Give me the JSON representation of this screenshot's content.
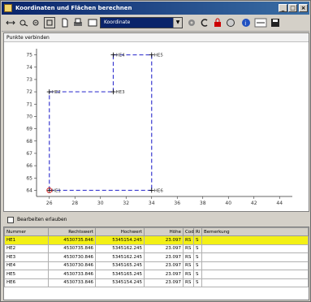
{
  "window": {
    "title": "Koordinaten und Flächen berechnen",
    "min_label": "_",
    "max_label": "□",
    "close_label": "×"
  },
  "toolbar": {
    "combo_value": "Koordinate",
    "tools": [
      "move-icon",
      "zoom-in-icon",
      "zoom-out-icon",
      "fit-icon",
      "new-icon",
      "print-icon",
      "settings-icon",
      "copy-icon",
      "save-icon",
      "info-icon",
      "calc-icon",
      "disk-icon"
    ]
  },
  "panel": {
    "title": "Punkte verbinden"
  },
  "chart_data": {
    "type": "line",
    "x_ticks": [
      "26",
      "28",
      "30",
      "32",
      "34",
      "36",
      "38",
      "40",
      "42",
      "44"
    ],
    "y_ticks": [
      "64",
      "65",
      "66",
      "67",
      "68",
      "69",
      "70",
      "71",
      "72",
      "73",
      "74",
      "75"
    ],
    "xlim": [
      25,
      45
    ],
    "ylim": [
      63.5,
      75.5
    ],
    "polygon": [
      {
        "label": "HE1",
        "x": 26,
        "y": 64
      },
      {
        "label": "HE2",
        "x": 26,
        "y": 72
      },
      {
        "label": "HE3",
        "x": 31,
        "y": 72
      },
      {
        "label": "HE4",
        "x": 31,
        "y": 75
      },
      {
        "label": "HE5",
        "x": 34,
        "y": 75
      },
      {
        "label": "HE6",
        "x": 34,
        "y": 64
      }
    ]
  },
  "options": {
    "checkbox_label": "Bearbeiten erlauben"
  },
  "table": {
    "headers": [
      "Nummer",
      "Rechtswert",
      "Hochwert",
      "Höhe",
      "Cod",
      "Ri",
      "Bemerkung"
    ],
    "rows": [
      [
        "HE1",
        "4530735.846",
        "5345154.245",
        "23.097",
        "RS",
        "S",
        ""
      ],
      [
        "HE2",
        "4530735.846",
        "5345162.245",
        "23.097",
        "RS",
        "S",
        ""
      ],
      [
        "HE3",
        "4530730.846",
        "5345162.245",
        "23.097",
        "RS",
        "S",
        ""
      ],
      [
        "HE4",
        "4530730.846",
        "5345165.245",
        "23.097",
        "RS",
        "S",
        ""
      ],
      [
        "HE5",
        "4530733.846",
        "5345165.245",
        "23.097",
        "RS",
        "S",
        ""
      ],
      [
        "HE6",
        "4530733.846",
        "5345154.245",
        "23.097",
        "RS",
        "S",
        ""
      ]
    ]
  }
}
